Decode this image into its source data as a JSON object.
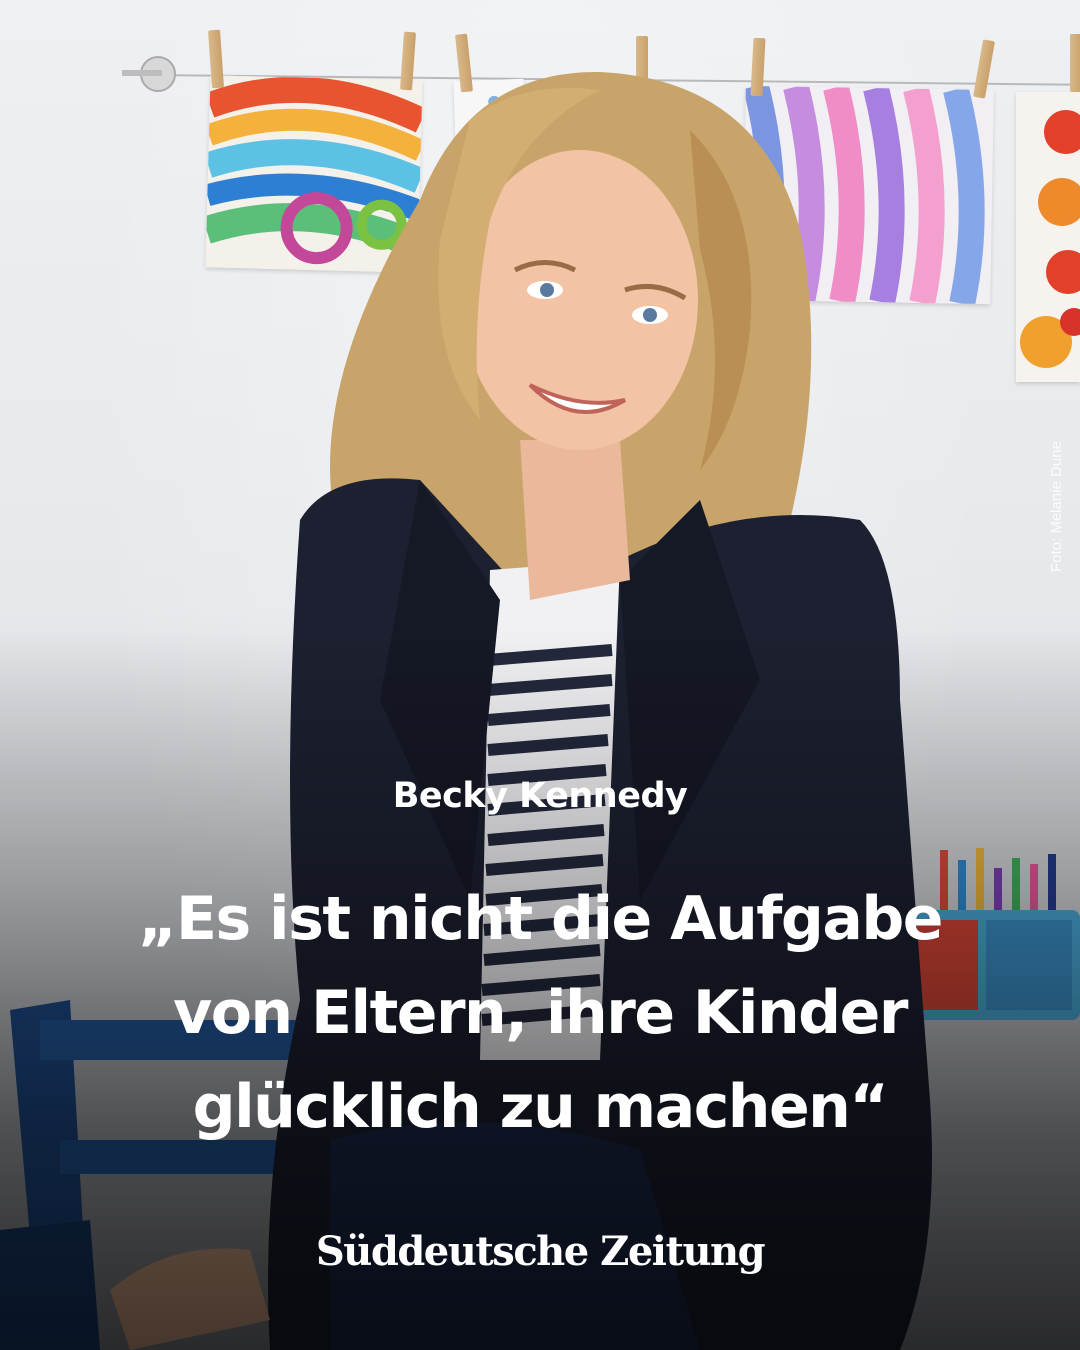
{
  "photo_credit": "Foto: Melanie Dune",
  "person_name": "Becky Kennedy",
  "quote_lines": [
    "„Es ist nicht die Aufgabe",
    "von Eltern, ihre Kinder",
    "glücklich zu machen“"
  ],
  "brand": "Süddeutsche Zeitung",
  "colors": {
    "text": "#ffffff",
    "blazer": "#1c2030",
    "hair": "#c9a46a",
    "chair": "#1f4c8c"
  }
}
